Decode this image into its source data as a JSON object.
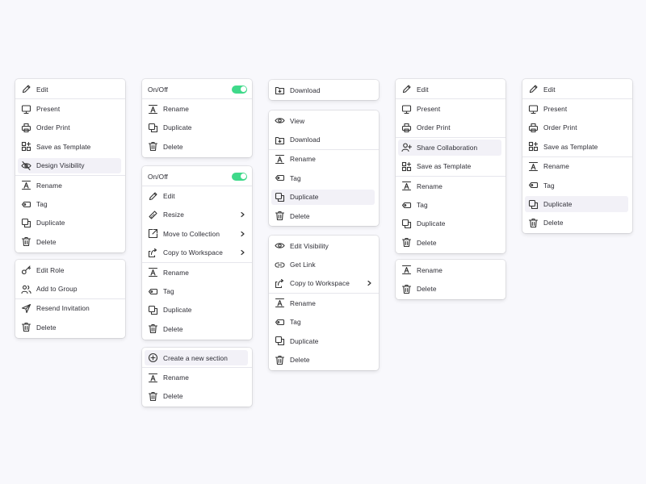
{
  "menus": {
    "m1": {
      "items": [
        "Edit",
        "Present",
        "Order Print",
        "Save as Template",
        "Design Visibility",
        "Rename",
        "Tag",
        "Duplicate",
        "Delete"
      ]
    },
    "m2": {
      "items": [
        "Edit Role",
        "Add to Group",
        "Resend Invitation",
        "Delete"
      ]
    },
    "m3": {
      "items": [
        "On/Off",
        "Rename",
        "Duplicate",
        "Delete"
      ]
    },
    "m4": {
      "items": [
        "On/Off",
        "Edit",
        "Resize",
        "Move to Collection",
        "Copy to Workspace",
        "Rename",
        "Tag",
        "Duplicate",
        "Delete"
      ]
    },
    "m5": {
      "items": [
        "Create a new section",
        "Rename",
        "Delete"
      ]
    },
    "m6": {
      "items": [
        "Download"
      ]
    },
    "m7": {
      "items": [
        "View",
        "Download",
        "Rename",
        "Tag",
        "Duplicate",
        "Delete"
      ]
    },
    "m8": {
      "items": [
        "Edit Visibility",
        "Get Link",
        "Copy to Workspace",
        "Rename",
        "Tag",
        "Duplicate",
        "Delete"
      ]
    },
    "m9": {
      "items": [
        "Edit",
        "Present",
        "Order Print",
        "Share Collaboration",
        "Save as Template",
        "Rename",
        "Tag",
        "Duplicate",
        "Delete"
      ]
    },
    "m10": {
      "items": [
        "Rename",
        "Delete"
      ]
    },
    "m11": {
      "items": [
        "Edit",
        "Present",
        "Order Print",
        "Save as Template",
        "Rename",
        "Tag",
        "Duplicate",
        "Delete"
      ]
    }
  },
  "colors": {
    "toggle_on": "#3fd98a",
    "selected_bg": "#f2f1f7",
    "background": "#f8f8fc"
  }
}
